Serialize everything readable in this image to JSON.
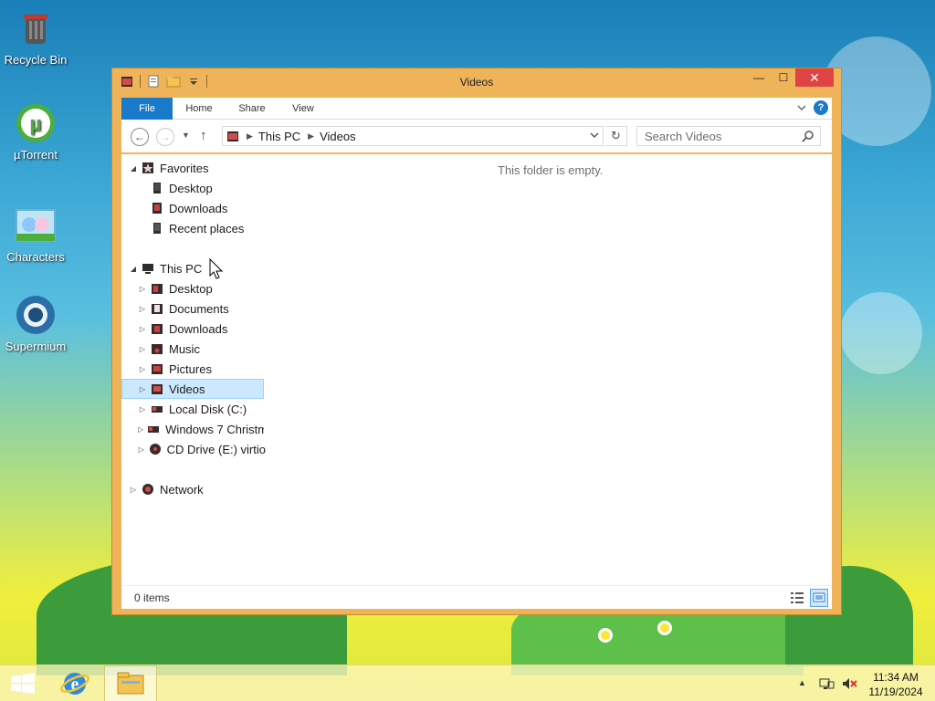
{
  "desktop": {
    "icons": [
      {
        "label": "Recycle Bin",
        "icon": "recycle-bin-icon"
      },
      {
        "label": "µTorrent",
        "icon": "utorrent-icon"
      },
      {
        "label": "Characters",
        "icon": "characters-icon"
      },
      {
        "label": "Supermium",
        "icon": "supermium-icon"
      }
    ]
  },
  "window": {
    "title": "Videos",
    "controls": {
      "minimize": "—",
      "maximize": "☐",
      "close": "✕"
    }
  },
  "ribbon": {
    "tabs": [
      "File",
      "Home",
      "Share",
      "View"
    ],
    "help": "?"
  },
  "address": {
    "back": "←",
    "forward": "→",
    "up": "↑",
    "crumbs": [
      "This PC",
      "Videos"
    ],
    "refresh": "↻"
  },
  "search": {
    "placeholder": "Search Videos"
  },
  "nav_tree": {
    "favorites": {
      "label": "Favorites",
      "items": [
        "Desktop",
        "Downloads",
        "Recent places"
      ]
    },
    "this_pc": {
      "label": "This PC",
      "items": [
        "Desktop",
        "Documents",
        "Downloads",
        "Music",
        "Pictures",
        "Videos",
        "Local Disk (C:)",
        "Windows 7 Christm",
        "CD Drive (E:) virtio"
      ],
      "selected": "Videos"
    },
    "network": {
      "label": "Network"
    }
  },
  "content": {
    "empty_message": "This folder is empty."
  },
  "status": {
    "items": "0 items"
  },
  "taskbar": {
    "items": [
      {
        "name": "Start",
        "icon": "windows-logo-icon"
      },
      {
        "name": "Internet Explorer",
        "icon": "internet-explorer-icon"
      },
      {
        "name": "File Explorer",
        "icon": "file-explorer-icon"
      }
    ],
    "tray_expand": "▲"
  },
  "clock": {
    "time": "11:34 AM",
    "date": "11/19/2024"
  },
  "colors": {
    "window_frame": "#efb35a",
    "file_tab": "#1979ca",
    "close_button": "#e04343",
    "selection": "#cce8ff"
  }
}
